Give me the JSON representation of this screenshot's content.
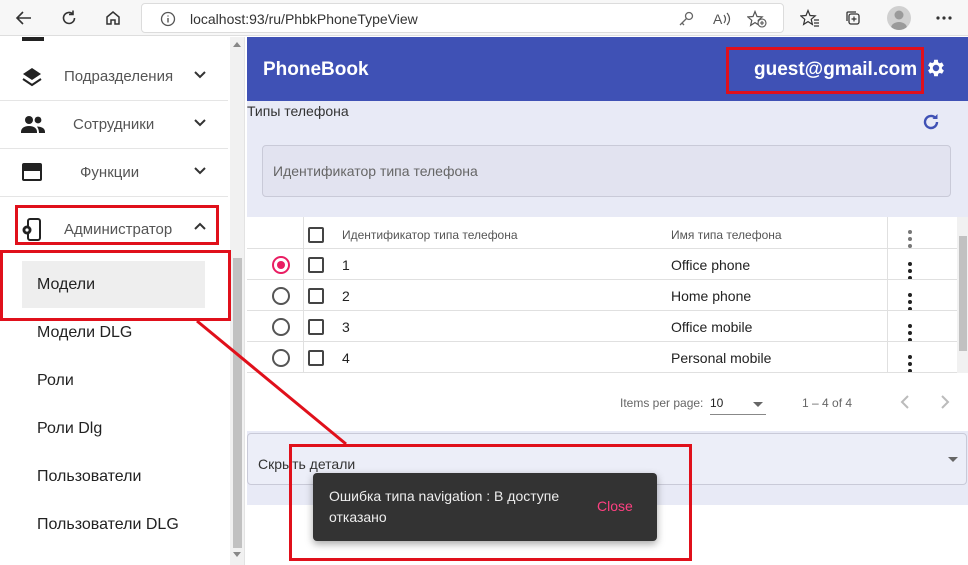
{
  "browser": {
    "url": "localhost:93/ru/PhbkPhoneTypeView"
  },
  "sidebar": {
    "items": [
      {
        "label": "Подразделения",
        "icon": "layers-icon"
      },
      {
        "label": "Сотрудники",
        "icon": "people-icon"
      },
      {
        "label": "Функции",
        "icon": "card-icon"
      },
      {
        "label": "Администратор",
        "icon": "phone-settings-icon"
      }
    ],
    "subitems": [
      {
        "label": "Модели"
      },
      {
        "label": "Модели DLG"
      },
      {
        "label": "Роли"
      },
      {
        "label": "Роли Dlg"
      },
      {
        "label": "Пользователи"
      },
      {
        "label": "Пользователи DLG"
      }
    ]
  },
  "header": {
    "title": "PhoneBook",
    "user": "guest@gmail.com",
    "color": "#3f51b5"
  },
  "panel": {
    "title": "Типы телефона",
    "filter_placeholder": "Идентификатор типа телефона"
  },
  "table": {
    "columns": [
      "Идентификатор типа телефона",
      "Имя типа телефона"
    ],
    "rows": [
      {
        "id": "1",
        "name": "Office phone",
        "selected": true
      },
      {
        "id": "2",
        "name": "Home phone",
        "selected": false
      },
      {
        "id": "3",
        "name": "Office mobile",
        "selected": false
      },
      {
        "id": "4",
        "name": "Personal mobile",
        "selected": false
      }
    ]
  },
  "paginator": {
    "items_per_page_label": "Items per page:",
    "page_size": "10",
    "range": "1 – 4 of 4"
  },
  "details": {
    "label": "Скрыть детали"
  },
  "snackbar": {
    "message": "Ошибка типа navigation : В доступе отказано",
    "action": "Close"
  },
  "colors": {
    "accent": "#e91e63",
    "annotation": "#e0101b"
  }
}
